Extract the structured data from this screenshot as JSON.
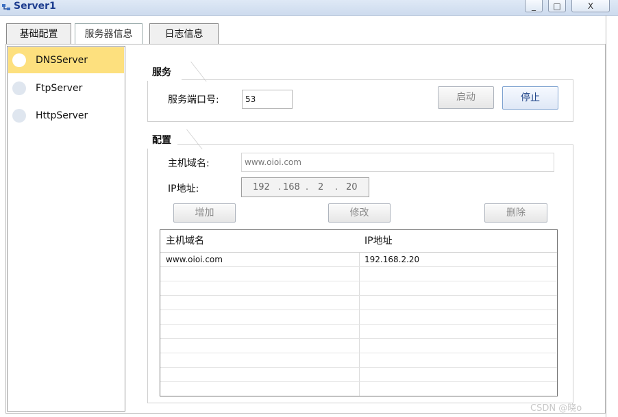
{
  "window": {
    "title": "Server1",
    "controls": {
      "minimize": "_",
      "maximize": "□",
      "close": "X"
    }
  },
  "tabs": [
    {
      "label": "基础配置"
    },
    {
      "label": "服务器信息"
    },
    {
      "label": "日志信息"
    }
  ],
  "services": [
    {
      "label": "DNSServer",
      "selected": true
    },
    {
      "label": "FtpServer",
      "selected": false
    },
    {
      "label": "HttpServer",
      "selected": false
    }
  ],
  "service_section": {
    "title": "服务",
    "port_label": "服务端口号:",
    "port_value": "53",
    "start_button": "启动",
    "stop_button": "停止"
  },
  "config_section": {
    "title": "配置",
    "domain_label": "主机域名:",
    "domain_value": "www.oioi.com",
    "ip_label": "IP地址:",
    "ip_octets": [
      "192",
      "168",
      "2",
      "20"
    ],
    "ip_dot": ".",
    "add_button": "增加",
    "modify_button": "修改",
    "delete_button": "删除"
  },
  "table": {
    "headers": [
      "主机域名",
      "IP地址"
    ],
    "rows": [
      [
        "www.oioi.com",
        "192.168.2.20"
      ]
    ]
  },
  "watermark": "CSDN @晓o"
}
